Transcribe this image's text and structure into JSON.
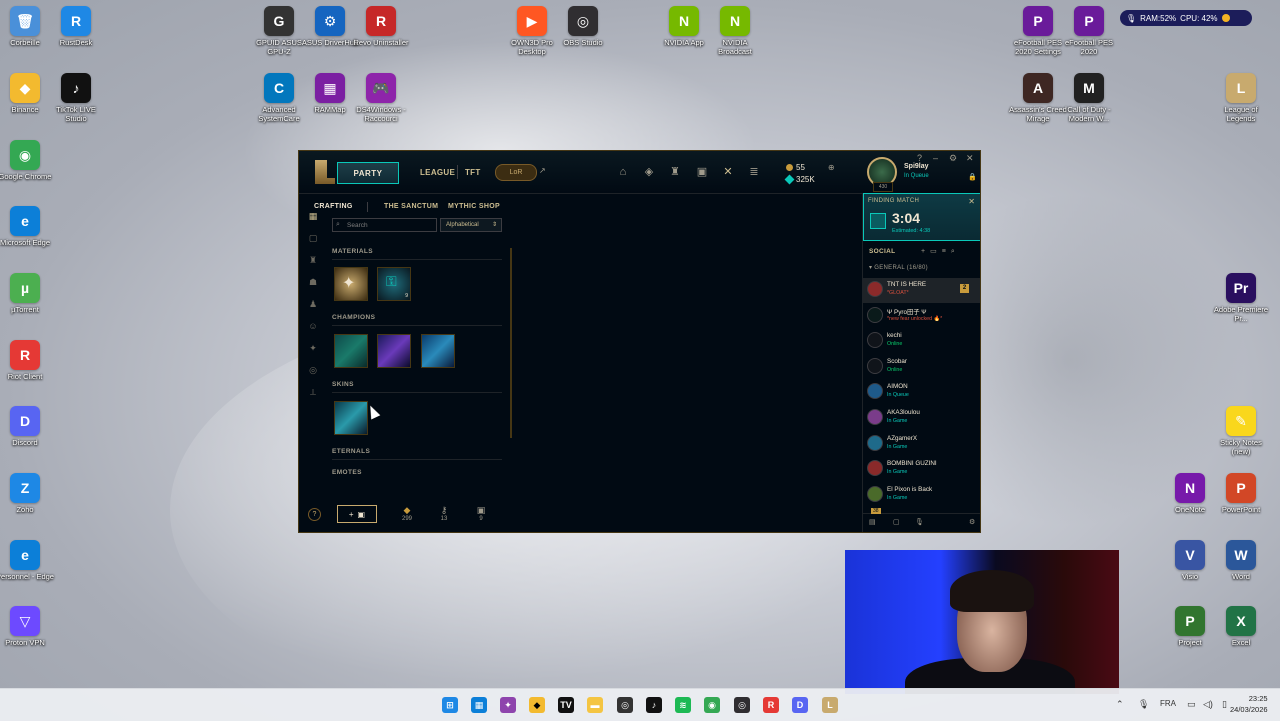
{
  "desktop": {
    "icons": [
      {
        "label": "Corbeille",
        "x": 0,
        "color": "#4a90d9",
        "glyph": "🗑"
      },
      {
        "label": "RustDesk",
        "color": "#1e88e5",
        "glyph": "R"
      },
      {
        "label": "Binance",
        "color": "#f3ba2f",
        "glyph": "◆"
      },
      {
        "label": "TikTok LIVE Studio",
        "color": "#111111",
        "glyph": "♪"
      },
      {
        "label": "Google Chrome",
        "color": "#34a853",
        "glyph": "◉"
      },
      {
        "label": "Microsoft Edge",
        "color": "#0c7fd8",
        "glyph": "e"
      },
      {
        "label": "µTorrent",
        "color": "#4caf50",
        "glyph": "µ"
      },
      {
        "label": "Riot Client",
        "color": "#e53935",
        "glyph": "R"
      },
      {
        "label": "Discord",
        "color": "#5865f2",
        "glyph": "D"
      },
      {
        "label": "Zoho",
        "color": "#1e88e5",
        "glyph": "Z"
      },
      {
        "label": "Personnel - Edge",
        "color": "#0c7fd8",
        "glyph": "e"
      },
      {
        "label": "Proton VPN",
        "color": "#6d4aff",
        "glyph": "▽"
      },
      {
        "label": "GPUID ASUS GPU-Z",
        "color": "#333333",
        "glyph": "G"
      },
      {
        "label": "ASUS DriverHub",
        "color": "#1565c0",
        "glyph": "⚙"
      },
      {
        "label": "Revo Uninstaller",
        "color": "#c62828",
        "glyph": "R"
      },
      {
        "label": "Advanced SystemCare",
        "color": "#0277bd",
        "glyph": "C"
      },
      {
        "label": "RAMMap",
        "color": "#7b1fa2",
        "glyph": "▦"
      },
      {
        "label": "DS4Windows - Raccourci",
        "color": "#8e24aa",
        "glyph": "🎮"
      },
      {
        "label": "OWN3D Pro Desktop",
        "color": "#ff5722",
        "glyph": "▶"
      },
      {
        "label": "OBS Studio",
        "color": "#302e31",
        "glyph": "◎"
      },
      {
        "label": "NVIDIA App",
        "color": "#76b900",
        "glyph": "N"
      },
      {
        "label": "NVIDIA Broadcast",
        "color": "#76b900",
        "glyph": "N"
      },
      {
        "label": "eFootball PES 2020 Settings",
        "color": "#6a1b9a",
        "glyph": "P"
      },
      {
        "label": "eFootball PES 2020",
        "color": "#6a1b9a",
        "glyph": "P"
      },
      {
        "label": "Assassin's Creed Mirage",
        "color": "#3e2723",
        "glyph": "A"
      },
      {
        "label": "Call of Duty - Modern W...",
        "color": "#212121",
        "glyph": "M"
      },
      {
        "label": "League of Legends",
        "color": "#c8aa6e",
        "glyph": "L"
      },
      {
        "label": "Adobe Premiere Pr...",
        "color": "#2a0f5f",
        "glyph": "Pr"
      },
      {
        "label": "Sticky Notes (new)",
        "color": "#f9d71c",
        "glyph": "✎"
      },
      {
        "label": "OneNote",
        "color": "#7719aa",
        "glyph": "N"
      },
      {
        "label": "PowerPoint",
        "color": "#d24726",
        "glyph": "P"
      },
      {
        "label": "Visio",
        "color": "#3955a3",
        "glyph": "V"
      },
      {
        "label": "Word",
        "color": "#2b579a",
        "glyph": "W"
      },
      {
        "label": "Project",
        "color": "#31752f",
        "glyph": "P"
      },
      {
        "label": "Excel",
        "color": "#217346",
        "glyph": "X"
      }
    ]
  },
  "perf_overlay": {
    "ram": "RAM:52%",
    "cpu": "CPU: 42%"
  },
  "client": {
    "party_label": "PARTY",
    "nav": [
      "LEAGUE",
      "TFT"
    ],
    "lor_label": "LoR",
    "rp": "55",
    "be": "325K",
    "level": "430",
    "username": "Spi9lay",
    "user_status": "In Queue",
    "subtabs": [
      "CRAFTING",
      "THE SANCTUM",
      "MYTHIC SHOP"
    ],
    "search_placeholder": "Search",
    "sort_value": "Alphabetical",
    "sections": [
      "MATERIALS",
      "CHAMPIONS",
      "SKINS",
      "ETERNALS",
      "EMOTES"
    ],
    "material_count": "9",
    "bottom": {
      "add_label": "+",
      "essence_orange": "299",
      "keys": "13",
      "chests": "9"
    }
  },
  "social": {
    "finding_title": "FINDING MATCH",
    "timer": "3:04",
    "estimated": "Estimated: 4:38",
    "header": "SOCIAL",
    "group": "GENERAL (16/80)",
    "friends": [
      {
        "name": "TNT IS HERE",
        "status": "*GLOAT*",
        "status_color": "#d94f3d",
        "badge": "2",
        "avatar": "#8b2a2a"
      },
      {
        "name": "Ψ Pyro田子 Ψ",
        "status": "*new fear unlocked 🔥*",
        "status_color": "#d94f3d",
        "avatar": "#0a1a1a"
      },
      {
        "name": "kechi",
        "status": "Online",
        "status_color": "#0acb6b",
        "avatar": "#10141a"
      },
      {
        "name": "Scobar",
        "status": "Online",
        "status_color": "#0acb6b",
        "avatar": "#10141a"
      },
      {
        "name": "AIMON",
        "status": "In Queue",
        "status_color": "#0ac8b9",
        "avatar": "#1e5a8a"
      },
      {
        "name": "AKA3loulou",
        "status": "In Game",
        "status_color": "#0ac8b9",
        "avatar": "#7a3c8a"
      },
      {
        "name": "AZgamerX",
        "status": "In Game",
        "status_color": "#0ac8b9",
        "avatar": "#1e6a8a"
      },
      {
        "name": "BOMBINI GUZINI",
        "status": "In Game",
        "status_color": "#0ac8b9",
        "avatar": "#8a2a2a"
      },
      {
        "name": "El Pixon is Back",
        "status": "In Game",
        "status_color": "#0ac8b9",
        "avatar": "#4a6a2a"
      }
    ],
    "footer_badge": "38"
  },
  "taskbar": {
    "language": "FRA",
    "time": "23:25",
    "date": "24/03/2026"
  }
}
